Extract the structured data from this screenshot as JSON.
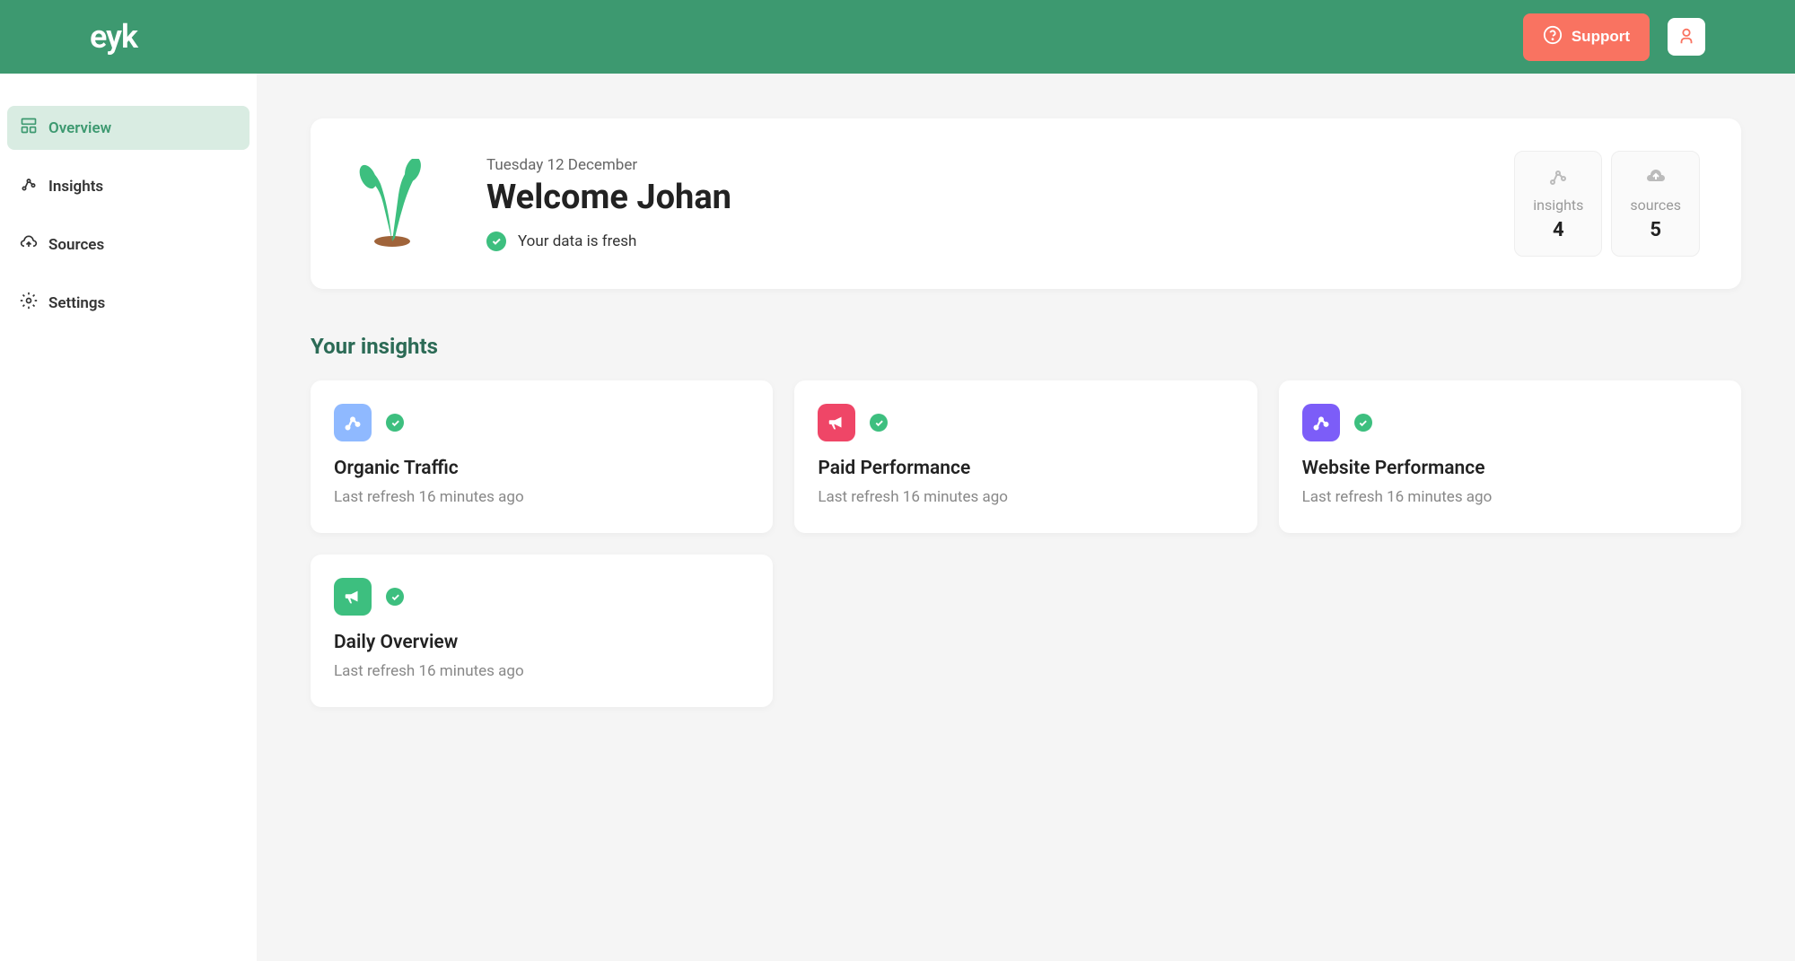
{
  "header": {
    "logo": "eyk",
    "support_label": "Support"
  },
  "sidebar": {
    "items": [
      {
        "label": "Overview",
        "active": true
      },
      {
        "label": "Insights",
        "active": false
      },
      {
        "label": "Sources",
        "active": false
      },
      {
        "label": "Settings",
        "active": false
      }
    ]
  },
  "welcome": {
    "date": "Tuesday 12 December",
    "title": "Welcome Johan",
    "status_text": "Your data is fresh"
  },
  "stats": {
    "insights": {
      "label": "insights",
      "value": "4"
    },
    "sources": {
      "label": "sources",
      "value": "5"
    }
  },
  "section": {
    "title": "Your insights"
  },
  "insights": [
    {
      "icon_color": "blue",
      "icon_type": "network",
      "title": "Organic Traffic",
      "subtitle": "Last refresh 16 minutes ago"
    },
    {
      "icon_color": "pink",
      "icon_type": "megaphone",
      "title": "Paid Performance",
      "subtitle": "Last refresh 16 minutes ago"
    },
    {
      "icon_color": "purple",
      "icon_type": "network",
      "title": "Website Performance",
      "subtitle": "Last refresh 16 minutes ago"
    },
    {
      "icon_color": "green",
      "icon_type": "megaphone",
      "title": "Daily Overview",
      "subtitle": "Last refresh 16 minutes ago"
    }
  ]
}
